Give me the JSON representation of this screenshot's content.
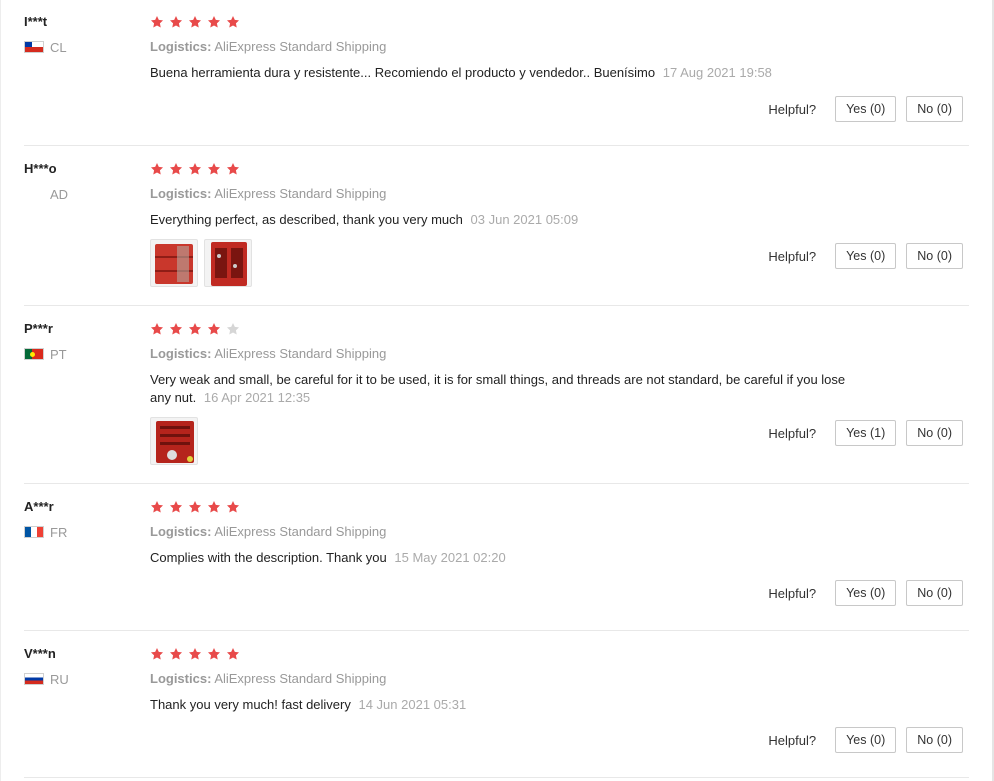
{
  "helpful_label": "Helpful?",
  "logistics_label": "Logistics:",
  "colors": {
    "star_filled": "#e84a4a",
    "star_empty": "#d6d6d6"
  },
  "reviews": [
    {
      "user": "I***t",
      "country": "CL",
      "flag": "chile-flag-icon",
      "rating": 5,
      "logistics": "AliExpress Standard Shipping",
      "text": "Buena herramienta dura y resistente... Recomiendo el producto y vendedor.. Buenísimo",
      "date": "17 Aug 2021 19:58",
      "yes": "Yes (0)",
      "no": "No (0)"
    },
    {
      "user": "H***o",
      "country": "AD",
      "flag": "",
      "rating": 5,
      "logistics": "AliExpress Standard Shipping",
      "text": "Everything perfect, as described, thank you very much",
      "date": "03 Jun 2021 05:09",
      "photos": 2,
      "yes": "Yes (0)",
      "no": "No (0)"
    },
    {
      "user": "P***r",
      "country": "PT",
      "flag": "portugal-flag-icon",
      "rating": 4,
      "logistics": "AliExpress Standard Shipping",
      "text": "Very weak and small, be careful for it to be used, it is for small things, and threads are not standard, be careful if you lose any nut.",
      "date": "16 Apr 2021 12:35",
      "photos": 1,
      "yes": "Yes (1)",
      "no": "No (0)"
    },
    {
      "user": "A***r",
      "country": "FR",
      "flag": "france-flag-icon",
      "rating": 5,
      "logistics": "AliExpress Standard Shipping",
      "text": "Complies with the description. Thank you",
      "date": "15 May 2021 02:20",
      "yes": "Yes (0)",
      "no": "No (0)"
    },
    {
      "user": "V***n",
      "country": "RU",
      "flag": "russia-flag-icon",
      "rating": 5,
      "logistics": "AliExpress Standard Shipping",
      "text": "Thank you very much! fast delivery",
      "date": "14 Jun 2021 05:31",
      "yes": "Yes (0)",
      "no": "No (0)"
    }
  ]
}
